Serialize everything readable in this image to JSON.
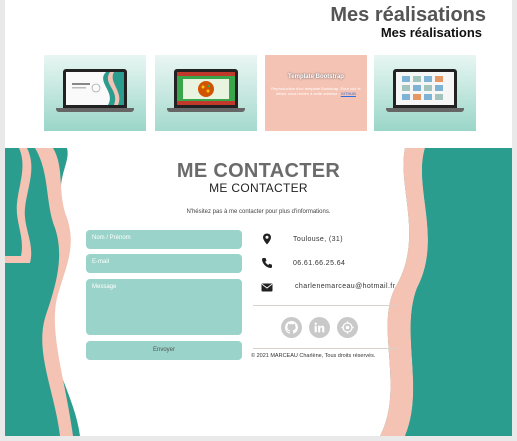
{
  "realisations": {
    "title_large": "Mes réalisations",
    "title_small": "Mes réalisations",
    "projects": [
      {
        "icon": "laptop-icon"
      },
      {
        "icon": "laptop-icon"
      },
      {
        "title": "Template Bootstrap",
        "text": "Reproduction d'un template Bootstrap. Pour voir le détail, vous rendre à cette adresse : ",
        "link": "GITHUB"
      },
      {
        "icon": "laptop-icon"
      }
    ]
  },
  "contact": {
    "title_large": "ME CONTACTER",
    "title_small": "ME CONTACTER",
    "intro": "N'hésitez pas à me contacter pour plus d'informations.",
    "form": {
      "name_placeholder": "Nom / Prénom",
      "email_placeholder": "E-mail",
      "message_placeholder": "Message",
      "submit_label": "Envoyer"
    },
    "info": {
      "address": "Toulouse, (31)",
      "phone": "06.61.66.25.64",
      "email": "charlenemarceau@hotmail.fr"
    },
    "social": [
      {
        "icon": "github-icon"
      },
      {
        "icon": "linkedin-icon"
      },
      {
        "icon": "portfolio-icon"
      }
    ],
    "copyright": "© 2021 MARCEAU Charlène, Tous droits réservés."
  },
  "colors": {
    "accent": "#2a9d8f",
    "field": "#9ad3c9",
    "wave": "#f4c3b4"
  }
}
